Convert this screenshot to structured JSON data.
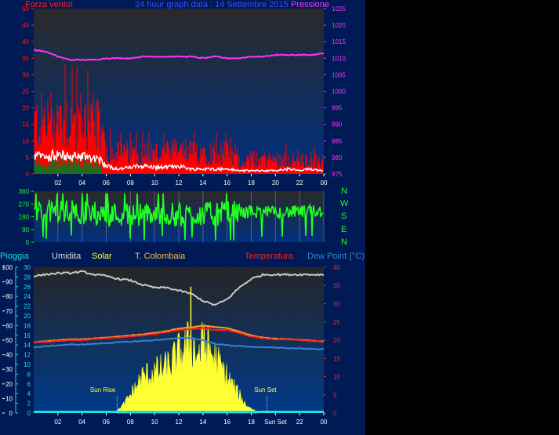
{
  "header": {
    "wind_label": "Forza vento!",
    "date_title": "24 hour graph data : 14 Settembre 2015",
    "pressure_label": "Pressione"
  },
  "legend": {
    "rain": "Pioggia",
    "humidity": "Umidita",
    "solar": "Solar",
    "colombaia": "T. Colombaia",
    "temperature": "Temperatura",
    "dewpoint": "Dew Point (°C)"
  },
  "compass": [
    "N",
    "W",
    "S",
    "E",
    "N"
  ],
  "annotations": {
    "sunrise": "Sun Rise",
    "sunset": "Sun Set"
  },
  "colors": {
    "panel_bg": "#001a55",
    "wind_gust": "#ff0000",
    "wind_avg": "#ffffff",
    "wind_dark": "#1f6b1f",
    "pressure": "#ff33ff",
    "direction": "#22ff22",
    "humidity": "#c8c8c8",
    "temperature": "#ff2020",
    "colombaia": "#ffa020",
    "dewpoint": "#2e86d6",
    "solar": "#ffff33",
    "rain": "#22dddd"
  },
  "chart_data": [
    {
      "type": "line",
      "name": "wind-pressure",
      "x_ticks": [
        "02",
        "04",
        "06",
        "08",
        "10",
        "12",
        "14",
        "16",
        "18",
        "20",
        "22",
        "00"
      ],
      "y_left_ticks": [
        0,
        5,
        10,
        15,
        20,
        25,
        30,
        35,
        40,
        45,
        50
      ],
      "y_left_lim": [
        0,
        50
      ],
      "y_right_ticks": [
        975,
        980,
        985,
        990,
        995,
        1000,
        1005,
        1010,
        1015,
        1020,
        1025
      ],
      "y_right_lim": [
        975,
        1025
      ],
      "x_range_hours": [
        0,
        24
      ],
      "gust_profile": {
        "hours": [
          0,
          1,
          2,
          3,
          4,
          5,
          5.5,
          6,
          7,
          8,
          9,
          10,
          11,
          12,
          13,
          14,
          15,
          16,
          17,
          18,
          19,
          20,
          21,
          22,
          23,
          24
        ],
        "values": [
          17,
          18,
          19,
          18,
          18,
          17,
          15,
          8,
          7,
          7,
          7,
          7,
          7,
          8,
          7,
          8,
          7,
          7,
          4,
          5,
          5,
          5,
          5,
          4,
          5,
          3
        ]
      },
      "avg_profile": {
        "hours": [
          0,
          1,
          2,
          3,
          4,
          5,
          5.5,
          6,
          7,
          8,
          9,
          10,
          11,
          12,
          13,
          14,
          15,
          16,
          17,
          18,
          19,
          20,
          21,
          22,
          23,
          24
        ],
        "values": [
          5.5,
          5,
          6,
          5,
          5.5,
          5,
          4,
          2.5,
          1.5,
          2,
          2.5,
          2,
          2,
          2.5,
          1.5,
          1.5,
          1.5,
          1.5,
          1,
          1,
          1,
          1,
          1.5,
          1,
          1.5,
          1
        ]
      },
      "pressure_profile": {
        "hours": [
          0,
          1,
          2,
          3,
          4,
          5,
          6,
          7,
          8,
          9,
          10,
          11,
          12,
          13,
          14,
          15,
          16,
          17,
          18,
          19,
          20,
          21,
          22,
          23,
          24
        ],
        "values": [
          1012.5,
          1012,
          1010.5,
          1009.5,
          1009.5,
          1009.5,
          1010,
          1010,
          1010,
          1010.5,
          1010.5,
          1010.5,
          1010.5,
          1010.5,
          1010,
          1010.5,
          1010,
          1010,
          1010.5,
          1010.5,
          1011,
          1011,
          1011,
          1011,
          1011.5
        ]
      }
    },
    {
      "type": "line",
      "name": "wind-direction",
      "x_ticks": [
        "02",
        "04",
        "06",
        "08",
        "10",
        "12",
        "14",
        "16",
        "18",
        "20",
        "22",
        "00"
      ],
      "y_ticks": [
        0,
        90,
        180,
        270,
        360
      ],
      "y_lim": [
        0,
        360
      ],
      "direction_profile": {
        "hours": [
          0,
          2,
          4,
          6,
          8,
          10,
          12,
          14,
          16,
          18,
          20,
          22,
          24
        ],
        "values": [
          215,
          220,
          210,
          200,
          195,
          200,
          190,
          200,
          205,
          215,
          210,
          215,
          225
        ]
      }
    },
    {
      "type": "line",
      "name": "temperature-humidity-solar",
      "x_ticks": [
        "02",
        "04",
        "06",
        "08",
        "10",
        "12",
        "14",
        "16",
        "18",
        "Sun Set",
        "22",
        "00"
      ],
      "y_hum_ticks": [
        0,
        10,
        20,
        30,
        40,
        50,
        60,
        70,
        80,
        90,
        100
      ],
      "y_hum_lim": [
        0,
        100
      ],
      "y_rain_ticks": [
        0,
        2,
        4,
        6,
        8,
        10,
        12,
        14,
        16,
        18,
        20,
        22,
        24,
        26,
        28,
        30
      ],
      "y_rain_lim": [
        0,
        30
      ],
      "y_temp_ticks": [
        0,
        5,
        10,
        15,
        20,
        25,
        30,
        35,
        40
      ],
      "y_temp_lim": [
        0,
        40
      ],
      "humidity": {
        "hours": [
          0,
          1,
          2,
          3,
          4,
          5,
          6,
          7,
          8,
          9,
          10,
          11,
          12,
          13,
          14,
          15,
          16,
          17,
          18,
          19,
          20,
          21,
          22,
          23,
          24
        ],
        "values": [
          94,
          95,
          96,
          96,
          97,
          95,
          94,
          92,
          91,
          88,
          86,
          86,
          84,
          82,
          77,
          74,
          78,
          86,
          92,
          95,
          95,
          95,
          95,
          95,
          95
        ]
      },
      "temperature": {
        "hours": [
          0,
          1,
          2,
          3,
          4,
          5,
          6,
          7,
          8,
          9,
          10,
          11,
          12,
          13,
          14,
          15,
          16,
          17,
          18,
          19,
          20,
          21,
          22,
          23,
          24
        ],
        "values": [
          19.5,
          19.5,
          19.8,
          20,
          20,
          20.3,
          20.5,
          20.8,
          21,
          21.3,
          21.7,
          22.2,
          22.8,
          23,
          23.3,
          22.8,
          22.8,
          22,
          21,
          20.5,
          20.2,
          20.2,
          20,
          19.8,
          19.5
        ]
      },
      "colombaia": {
        "hours": [
          0,
          1,
          2,
          3,
          4,
          5,
          6,
          7,
          8,
          9,
          10,
          11,
          12,
          13,
          14,
          15,
          16,
          17,
          18,
          19,
          20,
          21,
          22,
          23,
          24
        ],
        "values": [
          19.5,
          19.7,
          20,
          20.2,
          20.2,
          20.5,
          20.7,
          21,
          21.3,
          21.6,
          22,
          22.5,
          23.2,
          23.5,
          24,
          23.6,
          23.3,
          22.4,
          21.3,
          20.7,
          20.4,
          20.3,
          20.1,
          19.9,
          19.6
        ]
      },
      "dewpoint": {
        "hours": [
          0,
          1,
          2,
          3,
          4,
          5,
          6,
          7,
          8,
          9,
          10,
          11,
          12,
          13,
          14,
          15,
          16,
          17,
          18,
          19,
          20,
          21,
          22,
          23,
          24
        ],
        "values": [
          18,
          18.3,
          18.6,
          18.8,
          18.8,
          19,
          19.2,
          19.4,
          19.6,
          19.8,
          20,
          20.3,
          20.5,
          20.6,
          20,
          19,
          18.6,
          18.4,
          18.2,
          18,
          18,
          17.8,
          17.7,
          17.6,
          17.5
        ]
      },
      "solar": {
        "hours": [
          6.9,
          7.5,
          8,
          9,
          10,
          11,
          12,
          12.5,
          13,
          13.3,
          13.6,
          14,
          14.5,
          15,
          16,
          16.5,
          17,
          17.5,
          18,
          18.5
        ],
        "values": [
          0.5,
          2,
          4,
          8,
          9,
          10,
          13,
          14,
          16,
          14,
          13,
          15,
          14,
          12,
          8,
          6,
          4,
          2,
          1,
          0.3
        ]
      },
      "solar_spikes_hours": [
        13.0,
        14.1
      ],
      "solar_spikes_values": [
        26,
        18
      ],
      "rain_total": 0,
      "sunrise_hour": 6.9,
      "sunset_hour": 19.3
    }
  ]
}
